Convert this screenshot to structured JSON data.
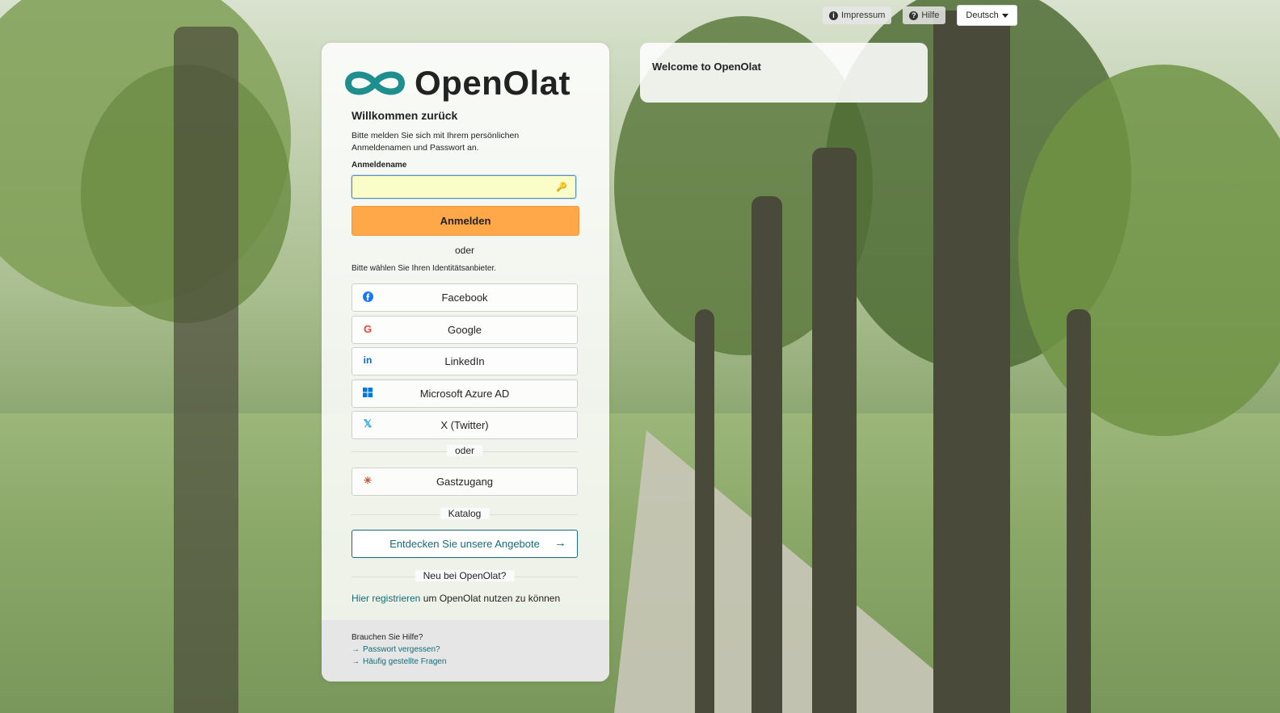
{
  "topbar": {
    "impressum_label": "Impressum",
    "hilfe_label": "Hilfe",
    "language_label": "Deutsch"
  },
  "login": {
    "brand": "OpenOlat",
    "welcome_title": "Willkommen zurück",
    "intro_text": "Bitte melden Sie sich mit Ihrem persönlichen Anmeldenamen und Passwort an.",
    "username_label": "Anmeldename",
    "username_value": "",
    "login_button": "Anmelden",
    "or_label_1": "oder",
    "idp_prompt": "Bitte wählen Sie Ihren Identitätsanbieter.",
    "providers": [
      {
        "label": "Facebook",
        "icon": "facebook-icon",
        "color": "#1877f2"
      },
      {
        "label": "Google",
        "icon": "google-icon",
        "color": "#ea4335"
      },
      {
        "label": "LinkedIn",
        "icon": "linkedin-icon",
        "color": "#0a66c2"
      },
      {
        "label": "Microsoft Azure AD",
        "icon": "windows-icon",
        "color": "#0078d4"
      },
      {
        "label": "X (Twitter)",
        "icon": "x-twitter-icon",
        "color": "#1da1f2"
      }
    ],
    "or_label_2": "oder",
    "guest_button": "Gastzugang",
    "catalog_label": "Katalog",
    "catalog_button": "Entdecken Sie unsere Angebote",
    "new_label": "Neu bei OpenOlat?",
    "register_link": "Hier registrieren",
    "register_rest": " um OpenOlat nutzen zu können"
  },
  "footer": {
    "help_title": "Brauchen Sie Hilfe?",
    "forgot_password": "Passwort vergessen?",
    "faq": "Häufig gestellte Fragen"
  },
  "welcome_box": {
    "title": "Welcome to OpenOlat"
  },
  "colors": {
    "accent_orange": "#ffa84a",
    "brand_teal": "#176b78",
    "logo_teal": "#1f8e8e"
  }
}
